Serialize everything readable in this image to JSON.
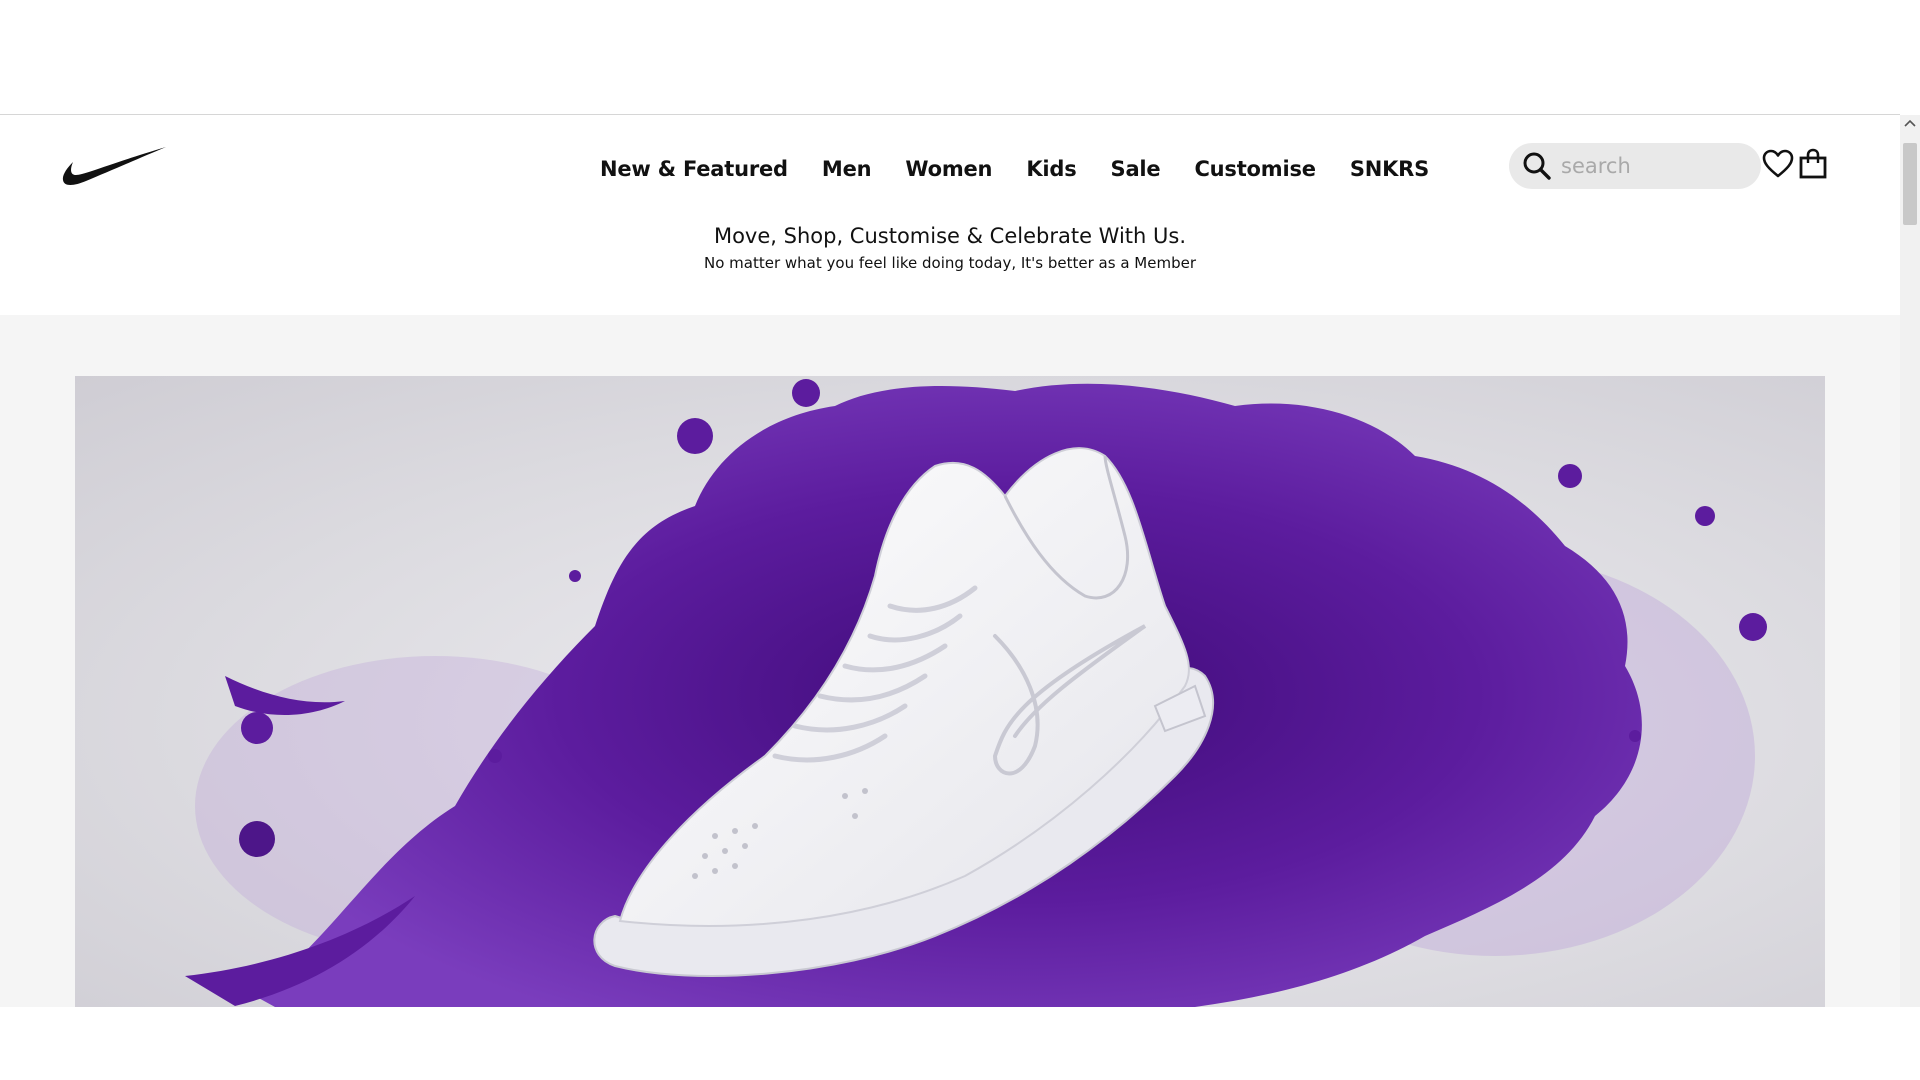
{
  "header": {
    "logo_icon": "nike-swoosh-icon",
    "nav": [
      {
        "label": "New & Featured"
      },
      {
        "label": "Men"
      },
      {
        "label": "Women"
      },
      {
        "label": "Kids"
      },
      {
        "label": "Sale"
      },
      {
        "label": "Customise"
      },
      {
        "label": "SNKRS"
      }
    ],
    "search": {
      "placeholder": "search",
      "icon": "search-icon"
    },
    "favorites_icon": "heart-icon",
    "bag_icon": "shopping-bag-icon"
  },
  "promo": {
    "title": "Move, Shop, Customise & Celebrate With Us.",
    "subtitle": "No matter what you feel like doing today, It's better as a Member"
  },
  "hero": {
    "image": "white sneaker on purple paint splash",
    "colors": {
      "splash": "#5a1a9a",
      "background": "#dcdbe0",
      "shoe": "#f7f7f9"
    }
  },
  "colors": {
    "text": "#111111",
    "page_background": "#f5f5f5",
    "search_background": "#e9e9e9"
  }
}
